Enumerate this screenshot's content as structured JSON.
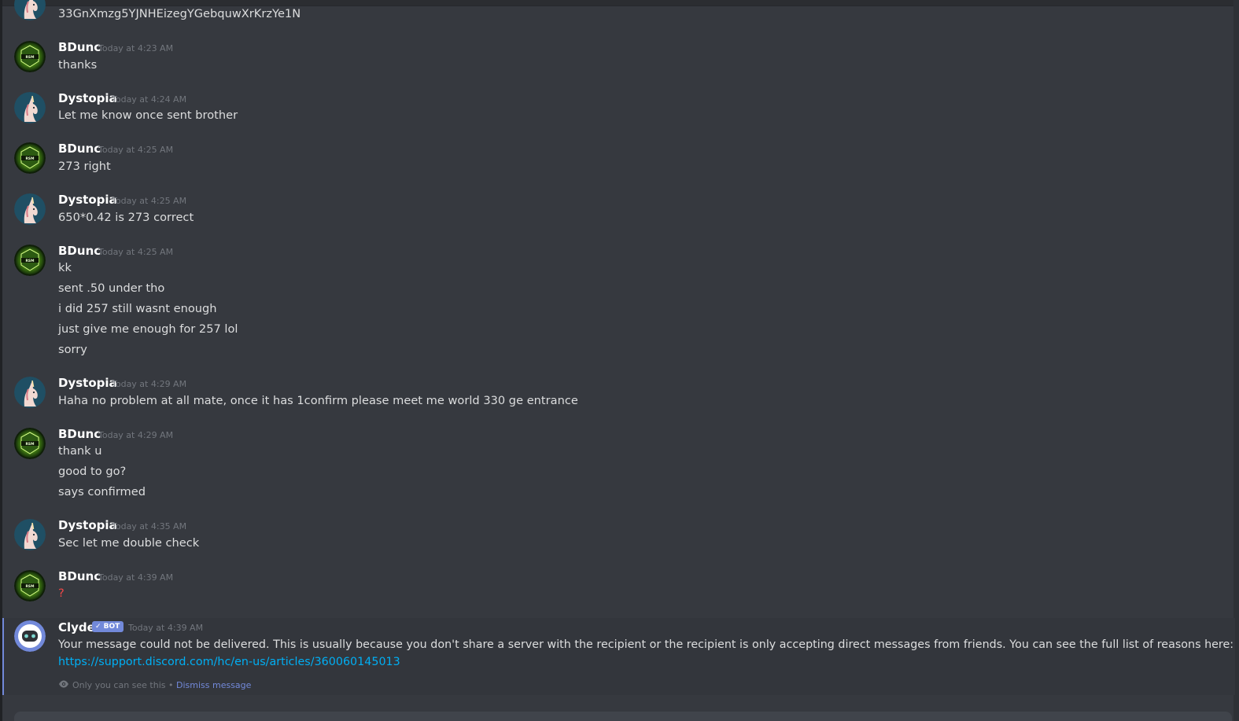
{
  "partial_top_message": {
    "text": "33GnXmzg5YJNHEizegYGebquwXrKrzYe1N"
  },
  "messages": [
    {
      "author": "BDunc",
      "time": "Today at 4:23 AM",
      "lines": [
        "thanks"
      ]
    },
    {
      "author": "Dystopia",
      "time": "Today at 4:24 AM",
      "lines": [
        "Let me know once sent brother"
      ]
    },
    {
      "author": "BDunc",
      "time": "Today at 4:25 AM",
      "lines": [
        "273 right"
      ]
    },
    {
      "author": "Dystopia",
      "time": "Today at 4:25 AM",
      "lines": [
        "650*0.42 is 273 correct"
      ]
    },
    {
      "author": "BDunc",
      "time": "Today at 4:25 AM",
      "lines": [
        "kk",
        "sent .50 under tho",
        "i did 257 still wasnt enough",
        "just give me enough for 257 lol",
        "sorry"
      ]
    },
    {
      "author": "Dystopia",
      "time": "Today at 4:29 AM",
      "lines": [
        "Haha no problem at all mate, once it has 1confirm please meet me world 330 ge entrance"
      ]
    },
    {
      "author": "BDunc",
      "time": "Today at 4:29 AM",
      "lines": [
        "thank u",
        "good to go?",
        "says confirmed"
      ]
    },
    {
      "author": "Dystopia",
      "time": "Today at 4:35 AM",
      "lines": [
        "Sec let me double check"
      ]
    },
    {
      "author": "BDunc",
      "time": "Today at 4:39 AM",
      "lines": [
        "?"
      ]
    }
  ],
  "clyde": {
    "author": "Clyde",
    "badge": "✓ BOT",
    "time": "Today at 4:39 AM",
    "text": "Your message could not be delivered. This is usually because you don't share a server with the recipient or the recipient is only accepting direct messages from friends. You can see the full list of reasons here:",
    "link": "https://support.discord.com/hc/en-us/articles/360060145013",
    "only_you": "Only you can see this",
    "separator": "•",
    "dismiss": "Dismiss message"
  },
  "icons": {
    "bdunc_avatar": "green-emblem-avatar-icon",
    "dystopia_avatar": "unicorn-avatar-icon",
    "clyde_avatar": "clyde-bot-avatar-icon",
    "eye": "eye-icon"
  },
  "colors": {
    "background": "#36393f",
    "ephemeral_background": "#33363c",
    "accent": "#7289da",
    "link": "#00aff4",
    "timestamp": "#72767d",
    "username": "#ffffff",
    "text": "#dcddde",
    "error_text": "#f04747"
  }
}
